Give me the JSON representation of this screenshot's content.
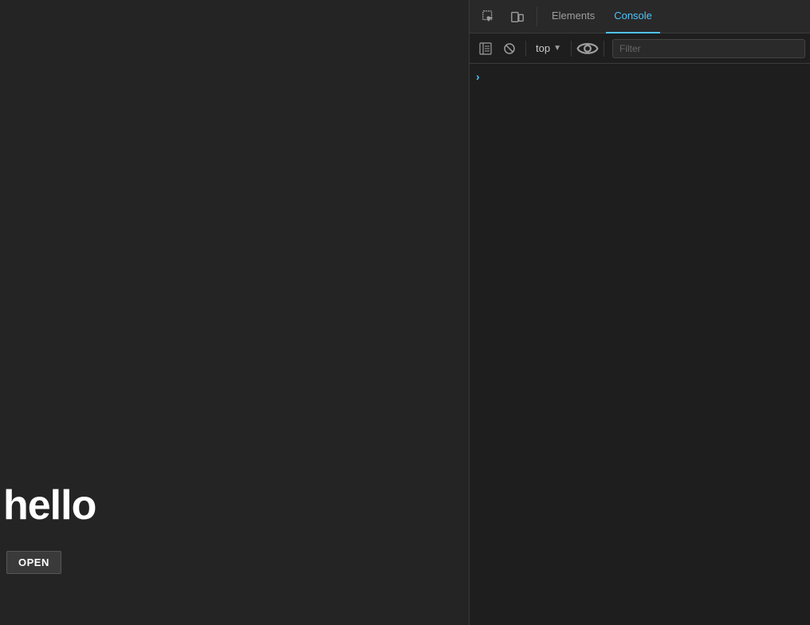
{
  "browser_content": {
    "hello_text": "hello",
    "open_button_label": "OPEN"
  },
  "devtools": {
    "tabs": [
      {
        "id": "elements",
        "label": "Elements",
        "active": false
      },
      {
        "id": "console",
        "label": "Console",
        "active": true
      }
    ],
    "toolbar": {
      "top_label": "top",
      "filter_placeholder": "Filter"
    },
    "console_prompt_chevron": "›"
  }
}
